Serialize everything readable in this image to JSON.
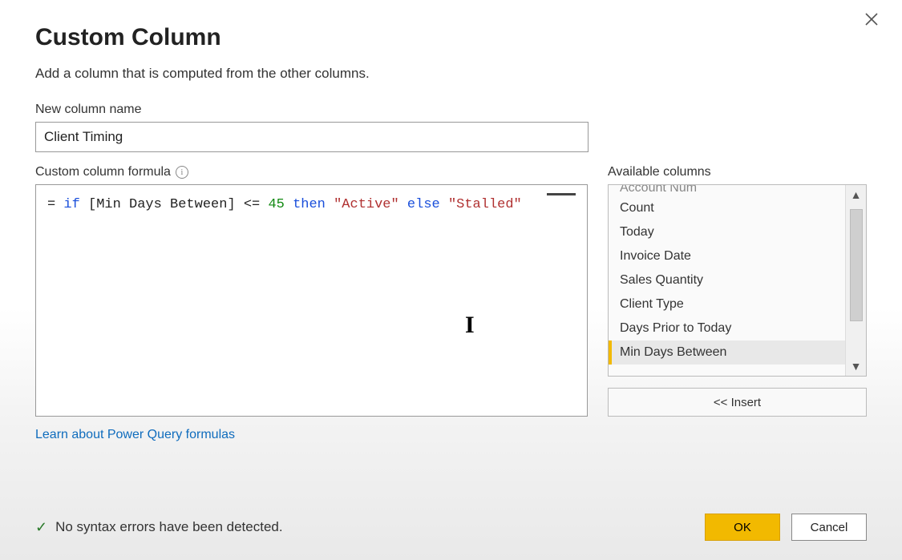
{
  "dialog": {
    "title": "Custom Column",
    "subtitle": "Add a column that is computed from the other columns.",
    "close_icon_name": "close-icon"
  },
  "name_field": {
    "label": "New column name",
    "value": "Client Timing"
  },
  "formula_field": {
    "label": "Custom column formula",
    "info_glyph": "i",
    "tokens": {
      "eq": "= ",
      "kw_if": "if",
      "ref": " [Min Days Between]",
      "op": " <= ",
      "num": "45",
      "kw_then": " then ",
      "str_active": "\"Active\"",
      "kw_else": " else ",
      "str_stalled": "\"Stalled\""
    },
    "raw": "= if [Min Days Between] <= 45 then \"Active\" else \"Stalled\""
  },
  "available": {
    "label": "Available columns",
    "partial_item": "Account Num",
    "items": [
      "Count",
      "Today",
      "Invoice Date",
      "Sales Quantity",
      "Client Type",
      "Days Prior to Today",
      "Min Days Between"
    ],
    "selected_index": 6,
    "insert_label": "<< Insert"
  },
  "link": {
    "label": "Learn about Power Query formulas"
  },
  "status": {
    "message": "No syntax errors have been detected.",
    "check_glyph": "✓"
  },
  "buttons": {
    "ok": "OK",
    "cancel": "Cancel"
  }
}
